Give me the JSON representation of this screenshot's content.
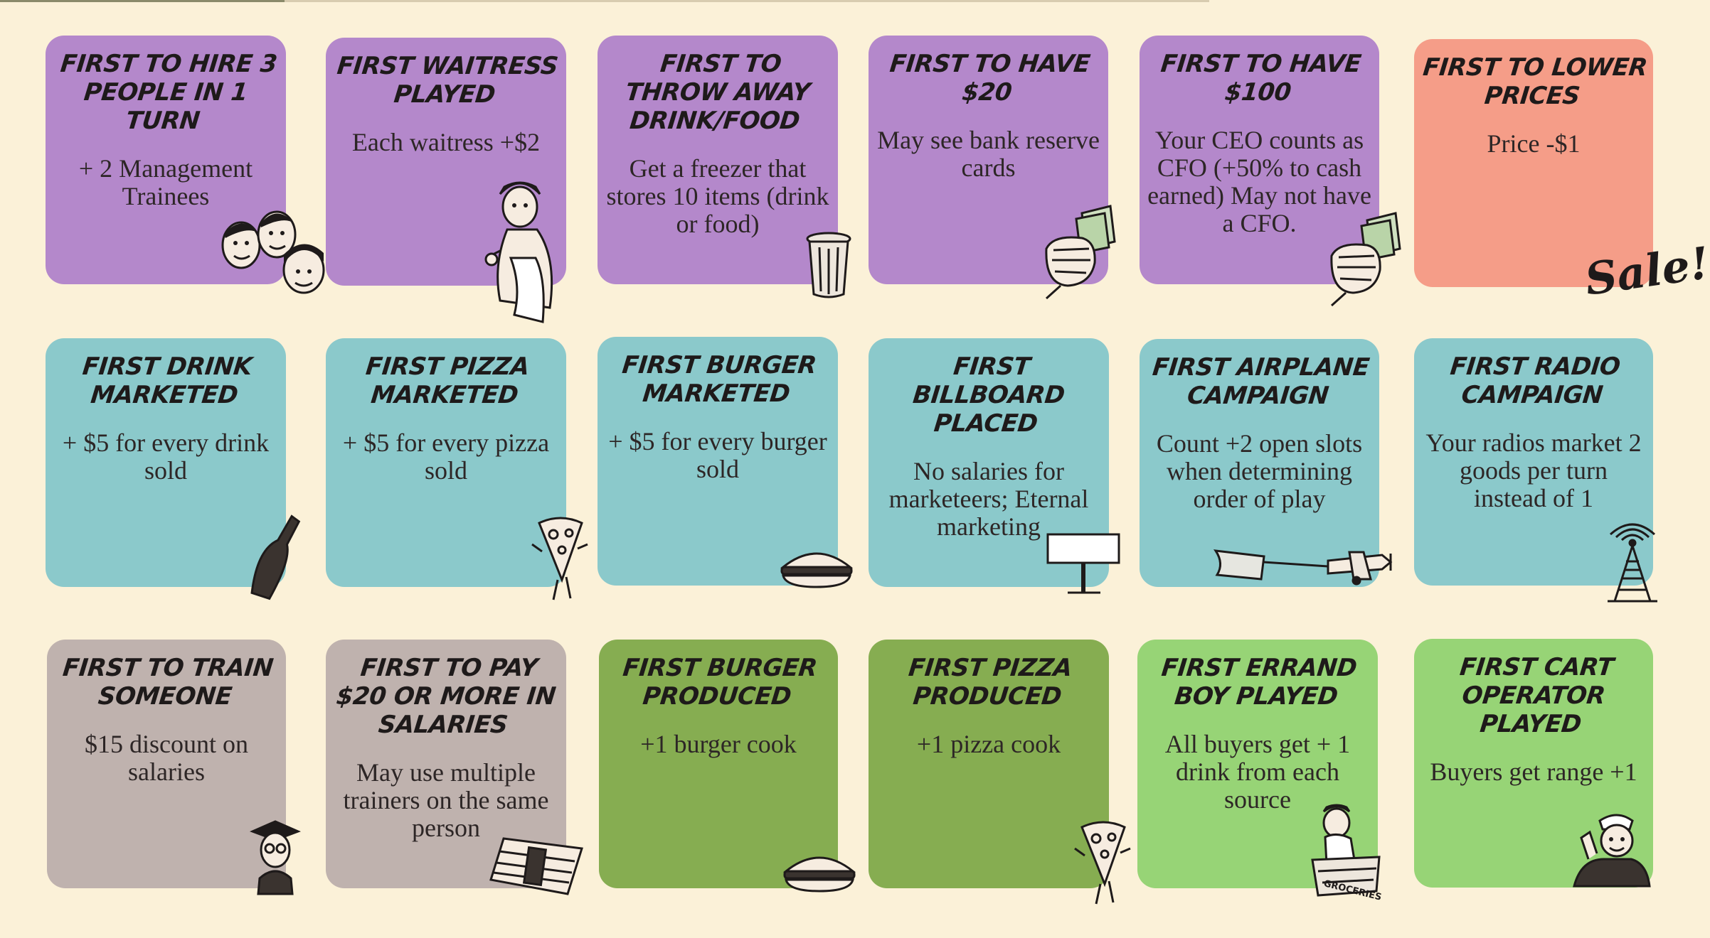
{
  "colors": {
    "background": "#fbf1d8",
    "purple": "#b488cb",
    "salmon": "#f59d88",
    "teal": "#8bc9cb",
    "grey": "#bfb2ae",
    "olive": "#86ad51",
    "lime": "#97d476",
    "ink": "#1e1a1a"
  },
  "cards": [
    {
      "title": "First to hire 3 people in 1 turn",
      "body": "+ 2 Management Trainees",
      "color": "purple",
      "icon": "three-men-icon"
    },
    {
      "title": "First waitress played",
      "body": "Each waitress  +$2",
      "color": "purple",
      "icon": "waitress-icon"
    },
    {
      "title": "First to throw away drink/food",
      "body": "Get a freezer that stores 10 items (drink or food)",
      "color": "purple",
      "icon": "trash-can-icon"
    },
    {
      "title": "First to have $20",
      "body": "May see bank reserve cards",
      "color": "purple",
      "icon": "fist-with-cash-icon"
    },
    {
      "title": "First to have $100",
      "body": "Your CEO counts as CFO  (+50% to cash earned) May not have a CFO.",
      "color": "purple",
      "icon": "fist-with-cash-icon"
    },
    {
      "title": "First to lower prices",
      "body": "Price -$1",
      "color": "salmon",
      "icon": "sale-script",
      "stamp": "Sale!"
    },
    {
      "title": "First drink marketed",
      "body": "+ $5 for every drink sold",
      "color": "teal",
      "icon": "bottle-icon"
    },
    {
      "title": "First pizza marketed",
      "body": "+ $5 for every pizza sold",
      "color": "teal",
      "icon": "pizza-slice-icon"
    },
    {
      "title": "First burger marketed",
      "body": "+ $5 for every burger sold",
      "color": "teal",
      "icon": "burger-icon"
    },
    {
      "title": "First billboard placed",
      "body": "No salaries for marketeers; Eternal marketing",
      "color": "teal",
      "icon": "billboard-icon"
    },
    {
      "title": "First airplane campaign",
      "body": "Count +2 open slots when determining order of play",
      "color": "teal",
      "icon": "airplane-banner-icon"
    },
    {
      "title": "First radio campaign",
      "body": "Your radios market 2 goods per turn instead of 1",
      "color": "teal",
      "icon": "radio-tower-icon"
    },
    {
      "title": "First to train someone",
      "body": "$15 discount on salaries",
      "color": "grey",
      "icon": "graduate-icon"
    },
    {
      "title": "First to pay $20 or more in salaries",
      "body": "May use multiple trainers on the same person",
      "color": "grey",
      "icon": "cash-stack-icon"
    },
    {
      "title": "First burger produced",
      "body": "+1 burger cook",
      "color": "olive",
      "icon": "burger-icon"
    },
    {
      "title": "First pizza produced",
      "body": "+1 pizza cook",
      "color": "olive",
      "icon": "pizza-slice-icon"
    },
    {
      "title": "First errand boy played",
      "body": "All buyers get + 1 drink from each source",
      "color": "lime",
      "icon": "errand-boy-icon",
      "stamp": "GROCERIES"
    },
    {
      "title": "First cart operator played",
      "body": "Buyers  get range +1",
      "color": "lime",
      "icon": "cart-operator-icon"
    }
  ]
}
